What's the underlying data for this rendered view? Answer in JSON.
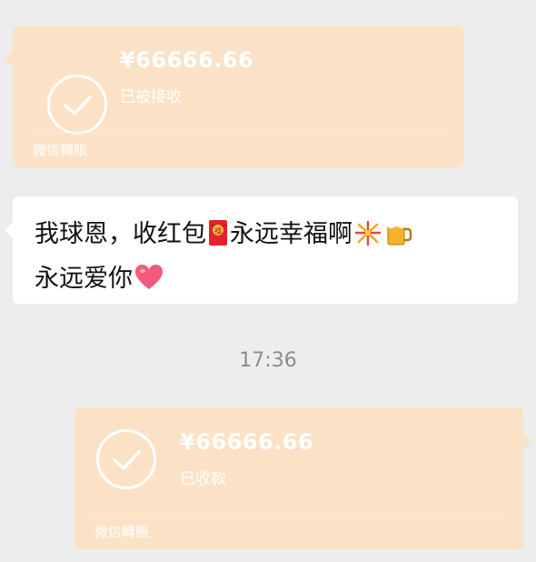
{
  "colors": {
    "background": "#ededed",
    "transfer_card": "#fbe2c7",
    "transfer_text": "#ffffff",
    "bubble": "#ffffff",
    "text": "#111111",
    "timestamp": "#8c8c8c",
    "heart": "#f25b7a",
    "red_envelope": "#e8202a"
  },
  "transfers": [
    {
      "amount": "¥66666.66",
      "status": "已被接收",
      "brand": "微信轉賬",
      "icon": "checkmark-circle-icon",
      "direction": "incoming"
    },
    {
      "amount": "¥66666.66",
      "status": "已收款",
      "brand": "微信轉賬",
      "icon": "checkmark-circle-icon",
      "direction": "outgoing"
    }
  ],
  "message": {
    "line1_part1": "我球恩，收红包",
    "line1_part2": "永远幸福啊",
    "line2": "永远爱你",
    "emojis": [
      "red-envelope-icon",
      "fireworks-icon",
      "beer-mug-icon",
      "heart-icon"
    ]
  },
  "timestamp": "17:36"
}
